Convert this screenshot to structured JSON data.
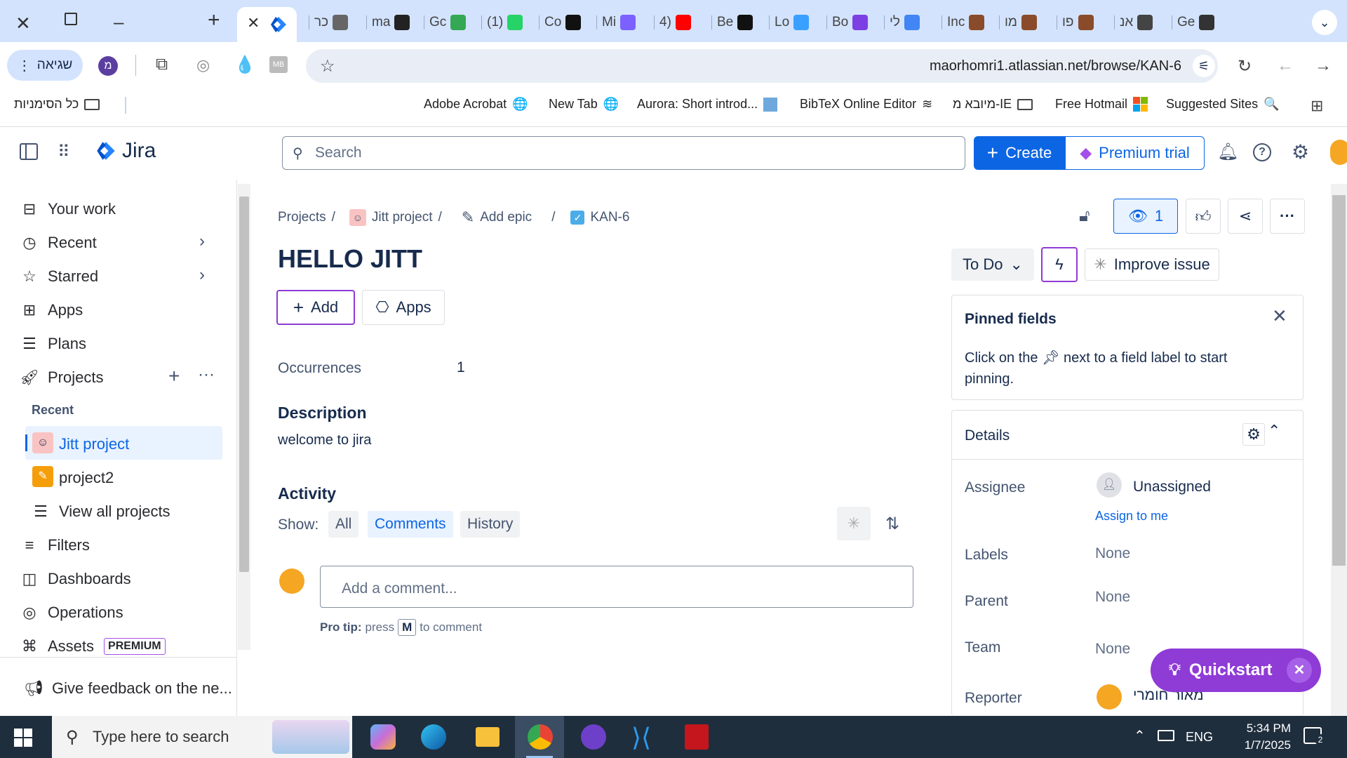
{
  "browser": {
    "tabs": [
      {
        "label": "",
        "icon": "jira-icon",
        "active": true
      },
      {
        "label": "כר",
        "icon": "chrome-icon"
      },
      {
        "label": "ma",
        "icon": "github-icon"
      },
      {
        "label": "Gc",
        "icon": "google-meet-icon"
      },
      {
        "label": "(1)",
        "icon": "whatsapp-icon"
      },
      {
        "label": "Co",
        "icon": "hi-icon"
      },
      {
        "label": "Mi",
        "icon": "app-icon"
      },
      {
        "label": "4)",
        "icon": "youtube-icon"
      },
      {
        "label": "Be",
        "icon": "hi-icon"
      },
      {
        "label": "Lo",
        "icon": "line-icon"
      },
      {
        "label": "Bo",
        "icon": "b-icon"
      },
      {
        "label": "לי",
        "icon": "docs-icon"
      },
      {
        "label": "Inc",
        "icon": "duck-icon"
      },
      {
        "label": "מו",
        "icon": "duck-icon"
      },
      {
        "label": "פו",
        "icon": "duck-icon"
      },
      {
        "label": "אנ",
        "icon": "wikipedia-icon"
      },
      {
        "label": "Ge",
        "icon": "openai-icon"
      }
    ],
    "profile_label": "שגיאה",
    "profile_initial": "מ",
    "url": "maorhomri1.atlassian.net/browse/KAN-6",
    "bookmarks": {
      "all_bookmarks": "כל הסימניות",
      "items": [
        "Adobe Acrobat",
        "New Tab",
        "Aurora: Short introd...",
        "BibTeX Online Editor",
        "מיובא מ-IE",
        "Free Hotmail",
        "Suggested Sites"
      ]
    }
  },
  "jira": {
    "product": "Jira",
    "search_placeholder": "Search",
    "create_label": "Create",
    "premium_label": "Premium trial"
  },
  "sidebar": {
    "items": [
      {
        "label": "Your work",
        "icon": "inbox-icon"
      },
      {
        "label": "Recent",
        "icon": "clock-icon"
      },
      {
        "label": "Starred",
        "icon": "star-icon"
      },
      {
        "label": "Apps",
        "icon": "apps-icon"
      },
      {
        "label": "Plans",
        "icon": "plans-icon"
      },
      {
        "label": "Projects",
        "icon": "rocket-icon"
      }
    ],
    "recent_heading": "Recent",
    "projects": [
      {
        "label": "Jitt project",
        "selected": true
      },
      {
        "label": "project2"
      }
    ],
    "view_all": "View all projects",
    "more_items": [
      {
        "label": "Filters",
        "icon": "filter-icon"
      },
      {
        "label": "Dashboards",
        "icon": "dashboard-icon"
      },
      {
        "label": "Operations",
        "icon": "operations-icon"
      },
      {
        "label": "Assets",
        "icon": "assets-icon",
        "badge": "PREMIUM"
      }
    ],
    "feedback": "Give feedback on the ne..."
  },
  "issue": {
    "breadcrumb": {
      "projects": "Projects",
      "project": "Jitt project",
      "epic": "Add epic",
      "key": "KAN-6"
    },
    "watchers": "1",
    "title": "HELLO JITT",
    "add_label": "Add",
    "apps_label": "Apps",
    "occurrences_label": "Occurrences",
    "occurrences_value": "1",
    "description_heading": "Description",
    "description_text": "welcome to jira",
    "activity_heading": "Activity",
    "show_label": "Show:",
    "activity_tabs": [
      "All",
      "Comments",
      "History"
    ],
    "active_activity_tab": "Comments",
    "comment_placeholder": "Add a comment...",
    "protip_bold": "Pro tip:",
    "protip_press": "press",
    "protip_key": "M",
    "protip_rest": "to comment",
    "status": "To Do",
    "improve_label": "Improve issue",
    "pinned": {
      "title": "Pinned fields",
      "text_before": "Click on the",
      "text_after": "next to a field label to start pinning."
    },
    "details": {
      "title": "Details",
      "assignee_label": "Assignee",
      "assignee_value": "Unassigned",
      "assign_to_me": "Assign to me",
      "labels_label": "Labels",
      "labels_value": "None",
      "parent_label": "Parent",
      "parent_value": "None",
      "team_label": "Team",
      "team_value": "None",
      "reporter_label": "Reporter",
      "reporter_value": "מאור חומרי"
    }
  },
  "quickstart_label": "Quickstart",
  "taskbar": {
    "search_placeholder": "Type here to search",
    "language": "ENG",
    "time": "5:34 PM",
    "date": "1/7/2025",
    "notifications": "2"
  },
  "colors": {
    "accent": "#0c66e4",
    "purple": "#8f3bd6",
    "taskbar": "#1f2e3d"
  }
}
